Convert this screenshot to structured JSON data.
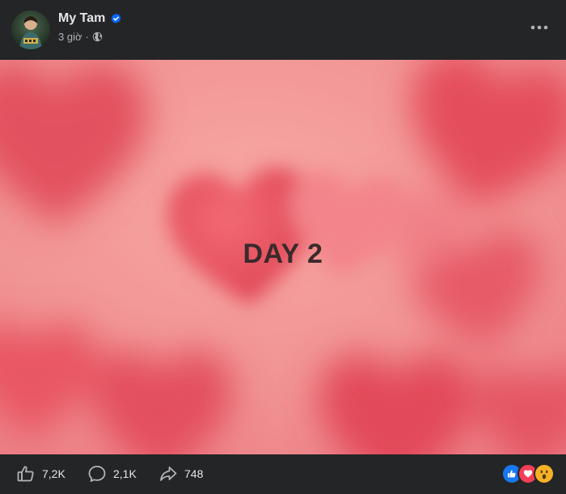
{
  "post": {
    "author": "My Tam",
    "time": "3 giờ",
    "separator": "·",
    "image_text": "DAY 2"
  },
  "stats": {
    "likes": "7,2K",
    "comments": "2,1K",
    "shares": "748"
  },
  "icons": {
    "verified": "verified-badge-icon",
    "audience": "globe-icon",
    "more": "more-options-icon",
    "like": "like-icon",
    "comment": "comment-icon",
    "share": "share-icon",
    "reactions": [
      "like-reaction-icon",
      "love-reaction-icon",
      "wow-reaction-icon"
    ]
  },
  "colors": {
    "background": "#242526",
    "text": "#e4e6eb",
    "secondary_text": "#b0b3b8",
    "verified_blue": "#0866ff",
    "image_pink": "#f0888a",
    "image_text": "#3a2a2c"
  }
}
